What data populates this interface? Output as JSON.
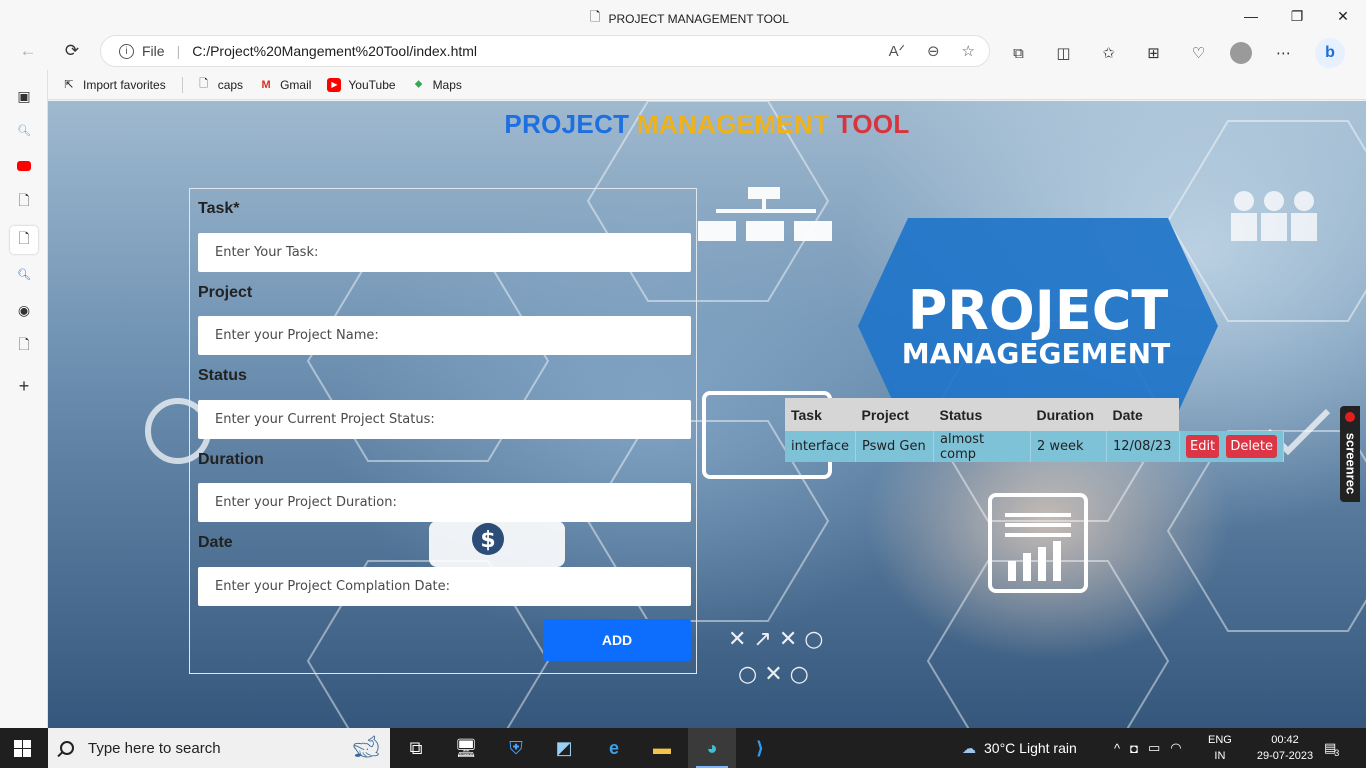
{
  "window": {
    "title": "PROJECT MANAGEMENT TOOL",
    "minimize": "—",
    "maximize": "❐",
    "close": "✕"
  },
  "address_bar": {
    "scheme_label": "File",
    "url": "C:/Project%20Mangement%20Tool/index.html"
  },
  "favorites": [
    {
      "label": "Import favorites",
      "icon": "import-icon"
    },
    {
      "label": "caps",
      "icon": "page-icon"
    },
    {
      "label": "Gmail",
      "icon": "gmail-icon"
    },
    {
      "label": "YouTube",
      "icon": "youtube-icon"
    },
    {
      "label": "Maps",
      "icon": "maps-icon"
    }
  ],
  "page": {
    "heading": {
      "w1": "PROJECT",
      "w2": "MANAGEMENT",
      "w3": "TOOL"
    },
    "colors": {
      "w1": "#1e6fe0",
      "w2": "#f0b21b",
      "w3": "#d9333d",
      "add_button": "#0d6efd",
      "danger": "#dc3545",
      "row_bg": "#7ec2d8"
    },
    "form": {
      "task_label": "Task*",
      "task_placeholder": "Enter Your Task:",
      "project_label": "Project",
      "project_placeholder": "Enter your Project Name:",
      "status_label": "Status",
      "status_placeholder": "Enter your Current Project Status:",
      "duration_label": "Duration",
      "duration_placeholder": "Enter your Project Duration:",
      "date_label": "Date",
      "date_placeholder": "Enter your Project Complation Date:",
      "add_label": "ADD"
    },
    "background_text": {
      "line1": "PROJECT",
      "line2": "MANAGEGEMENT"
    },
    "table": {
      "headers": [
        "Task",
        "Project",
        "Status",
        "Duration",
        "Date"
      ],
      "rows": [
        {
          "task": "interface",
          "project": "Pswd Gen",
          "status": "almost comp",
          "duration": "2 week",
          "date": "12/08/23",
          "edit": "Edit",
          "delete": "Delete"
        }
      ]
    }
  },
  "screenrec_label": "screenrec",
  "taskbar": {
    "search_placeholder": "Type here to search",
    "weather": "30°C  Light rain",
    "lang_line1": "ENG",
    "lang_line2": "IN",
    "time": "00:42",
    "date": "29-07-2023",
    "notification_count": "3"
  }
}
